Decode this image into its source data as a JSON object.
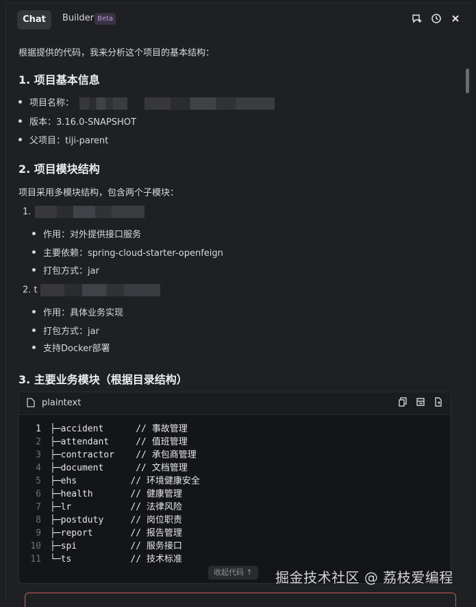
{
  "tabs": {
    "chat": "Chat",
    "builder": "Builder",
    "beta": "Beta"
  },
  "top_icons": [
    "new-chat-icon",
    "history-icon",
    "close-icon"
  ],
  "intro": "根据提供的代码，我来分析这个项目的基本结构：",
  "section1": {
    "title": "1. 项目基本信息",
    "items": [
      "项目名称：",
      "版本：3.16.0-SNAPSHOT",
      "父项目：tiji-parent"
    ]
  },
  "section2": {
    "title": "2. 项目模块结构",
    "desc": "项目采用多模块结构，包含两个子模块：",
    "module1": {
      "num": "1.",
      "items": [
        "作用：对外提供接口服务",
        "主要依赖：spring-cloud-starter-openfeign",
        "打包方式：jar"
      ]
    },
    "module2": {
      "num": "2. t",
      "items": [
        "作用：具体业务实现",
        "打包方式：jar",
        "支持Docker部署"
      ]
    }
  },
  "section3": {
    "title": "3. 主要业务模块（根据目录结构）"
  },
  "code": {
    "lang": "plaintext",
    "lines": [
      {
        "n": "1",
        "t": "├─accident      // 事故管理"
      },
      {
        "n": "2",
        "t": "├─attendant     // 值班管理"
      },
      {
        "n": "3",
        "t": "├─contractor    // 承包商管理"
      },
      {
        "n": "4",
        "t": "├─document      // 文档管理"
      },
      {
        "n": "5",
        "t": "├─ehs          // 环境健康安全"
      },
      {
        "n": "6",
        "t": "├─health       // 健康管理"
      },
      {
        "n": "7",
        "t": "├─lr           // 法律风险"
      },
      {
        "n": "8",
        "t": "├─postduty     // 岗位职责"
      },
      {
        "n": "9",
        "t": "├─report       // 报告管理"
      },
      {
        "n": "10",
        "t": "├─spi          // 服务接口"
      },
      {
        "n": "11",
        "t": "└─ts           // 技术标准"
      }
    ],
    "collapse": "收起代码 ↑"
  },
  "watermark": "掘金技术社区 @ 荔枝爱编程"
}
